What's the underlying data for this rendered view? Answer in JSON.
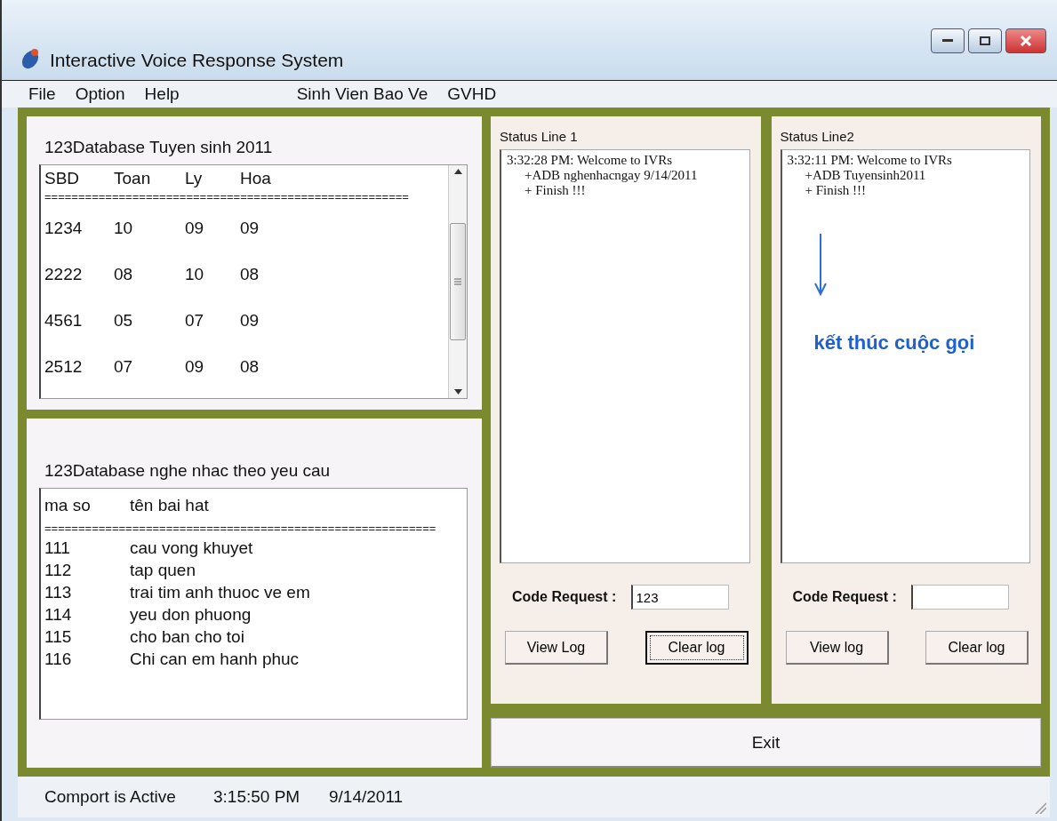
{
  "window": {
    "title": "Interactive Voice Response System"
  },
  "menu": [
    {
      "label": "File"
    },
    {
      "label": "Option"
    },
    {
      "label": "Help"
    }
  ],
  "menu_extra": [
    {
      "label": "Sinh Vien Bao Ve"
    },
    {
      "label": "GVHD"
    }
  ],
  "scores": {
    "title": "123Database Tuyen sinh 2011",
    "columns": [
      "SBD",
      "Toan",
      "Ly",
      "Hoa"
    ],
    "separator": "======================================================",
    "rows": [
      [
        "1234",
        "10",
        "09",
        "09"
      ],
      [
        "2222",
        "08",
        "10",
        "08"
      ],
      [
        "4561",
        "05",
        "07",
        "09"
      ],
      [
        "2512",
        "07",
        "09",
        "08"
      ]
    ]
  },
  "songs": {
    "title": "123Database nghe nhac theo yeu cau",
    "columns": [
      "ma so",
      "tên bai hat"
    ],
    "separator": "==========================================================",
    "rows": [
      [
        "111",
        "cau vong khuyet"
      ],
      [
        "112",
        "tap quen"
      ],
      [
        "113",
        "trai tim anh thuoc ve em"
      ],
      [
        "114",
        "yeu don phuong"
      ],
      [
        "115",
        "cho ban cho toi"
      ],
      [
        "116",
        "Chi can em hanh phuc"
      ]
    ]
  },
  "lines": [
    {
      "title": "Status Line 1",
      "log": [
        "3:32:28 PM: Welcome to IVRs",
        "+ADB nghenhacngay 9/14/2011",
        "+ Finish !!!"
      ],
      "code_label": "Code Request :",
      "code_value": "123",
      "buttons": [
        {
          "label": "View Log",
          "focused": false
        },
        {
          "label": "Clear log",
          "focused": true
        }
      ]
    },
    {
      "title": "Status Line2",
      "log": [
        "3:32:11 PM: Welcome to IVRs",
        "+ADB  Tuyensinh2011",
        "+ Finish !!!"
      ],
      "annotation": "kết thúc cuộc gọi",
      "code_label": "Code Request :",
      "buttons": [
        {
          "label": "View log",
          "focused": false
        },
        {
          "label": "Clear log",
          "focused": false
        }
      ]
    }
  ],
  "exit_button": {
    "label": "Exit"
  },
  "status_bar": [
    "Comport is Active",
    "3:15:50 PM",
    "9/14/2011"
  ]
}
